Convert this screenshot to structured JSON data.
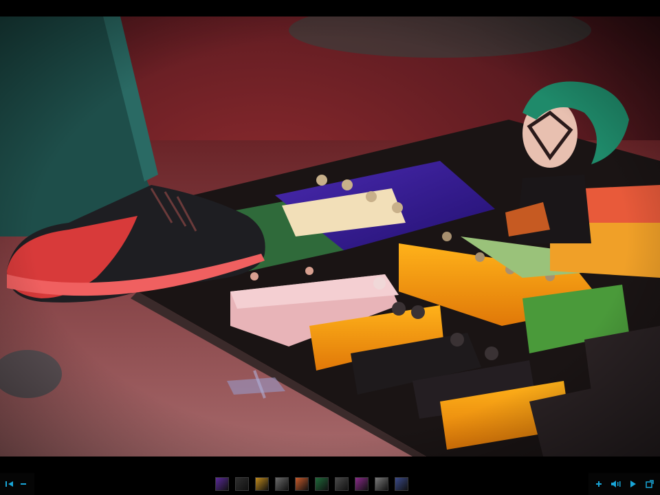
{
  "viewer": {
    "accent_color": "#19a6d8",
    "photo": {
      "subject": "guitar-pedalboard-photo"
    },
    "toolbar": {
      "left_buttons": [
        {
          "icon": "skip-to-start-icon"
        },
        {
          "icon": "zoom-out-minus-icon"
        }
      ],
      "thumbnails": [
        {
          "icon": "thumbnail-purple-stage",
          "color": "#5b2a9a"
        },
        {
          "icon": "thumbnail-guitarist",
          "color": "#2e2e2e"
        },
        {
          "icon": "thumbnail-yellow-stage",
          "color": "#c08a1c"
        },
        {
          "icon": "thumbnail-bw-performer",
          "color": "#6a6a6a"
        },
        {
          "icon": "thumbnail-orange-pedals",
          "color": "#c85a2a"
        },
        {
          "icon": "thumbnail-green-stage",
          "color": "#1f6a3a"
        },
        {
          "icon": "thumbnail-bw-band",
          "color": "#4a4a4a"
        },
        {
          "icon": "thumbnail-violet-lights",
          "color": "#8a2a8a"
        },
        {
          "icon": "thumbnail-grey-crowd",
          "color": "#7a7a7a"
        },
        {
          "icon": "thumbnail-blue-orange-stage",
          "color": "#3a4a8a"
        }
      ],
      "right_buttons": [
        {
          "icon": "zoom-in-plus-icon"
        },
        {
          "icon": "sound-toggle-icon"
        },
        {
          "icon": "play-icon"
        },
        {
          "icon": "fullscreen-icon"
        }
      ]
    }
  }
}
